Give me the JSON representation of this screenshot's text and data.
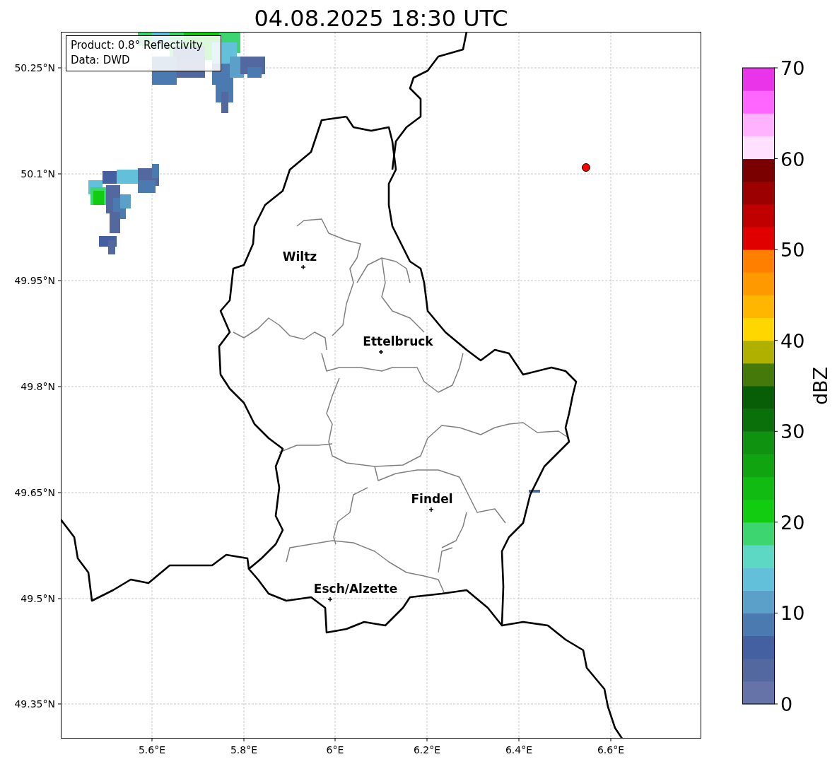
{
  "title": "04.08.2025 18:30 UTC",
  "info_box": {
    "lines": [
      "Product: 0.8° Reflectivity",
      "Data: DWD"
    ]
  },
  "map": {
    "yticks": [
      "50.25°N",
      "50.1°N",
      "49.95°N",
      "49.8°N",
      "49.65°N",
      "49.5°N",
      "49.35°N"
    ],
    "xticks": [
      "5.6°E",
      "5.8°E",
      "6°E",
      "6.2°E",
      "6.4°E",
      "6.6°E"
    ],
    "cities": [
      {
        "name": "Wiltz"
      },
      {
        "name": "Ettelbruck"
      },
      {
        "name": "Findel"
      },
      {
        "name": "Esch/Alzette"
      }
    ],
    "marker": {
      "color": "#ff0000"
    }
  },
  "colorbar": {
    "label": "dBZ",
    "ticks": [
      "70",
      "60",
      "50",
      "40",
      "30",
      "20",
      "10",
      "0"
    ],
    "bands": [
      {
        "color": "#6673a8"
      },
      {
        "color": "#52689f"
      },
      {
        "color": "#4460a0"
      },
      {
        "color": "#4a7ab0"
      },
      {
        "color": "#5aa0c8"
      },
      {
        "color": "#63c0da"
      },
      {
        "color": "#5dd8c5"
      },
      {
        "color": "#3dd56f"
      },
      {
        "color": "#12cc12"
      },
      {
        "color": "#11bb11"
      },
      {
        "color": "#10a410"
      },
      {
        "color": "#0f920f"
      },
      {
        "color": "#0a700a"
      },
      {
        "color": "#075e07"
      },
      {
        "color": "#457a0b"
      },
      {
        "color": "#b0b000"
      },
      {
        "color": "#ffd700"
      },
      {
        "color": "#ffb600"
      },
      {
        "color": "#ff9900"
      },
      {
        "color": "#ff7f00"
      },
      {
        "color": "#e00000"
      },
      {
        "color": "#c00000"
      },
      {
        "color": "#9c0000"
      },
      {
        "color": "#7a0000"
      },
      {
        "color": "#ffe0ff"
      },
      {
        "color": "#ffb3ff"
      },
      {
        "color": "#ff66ff"
      },
      {
        "color": "#e934e9"
      }
    ]
  }
}
